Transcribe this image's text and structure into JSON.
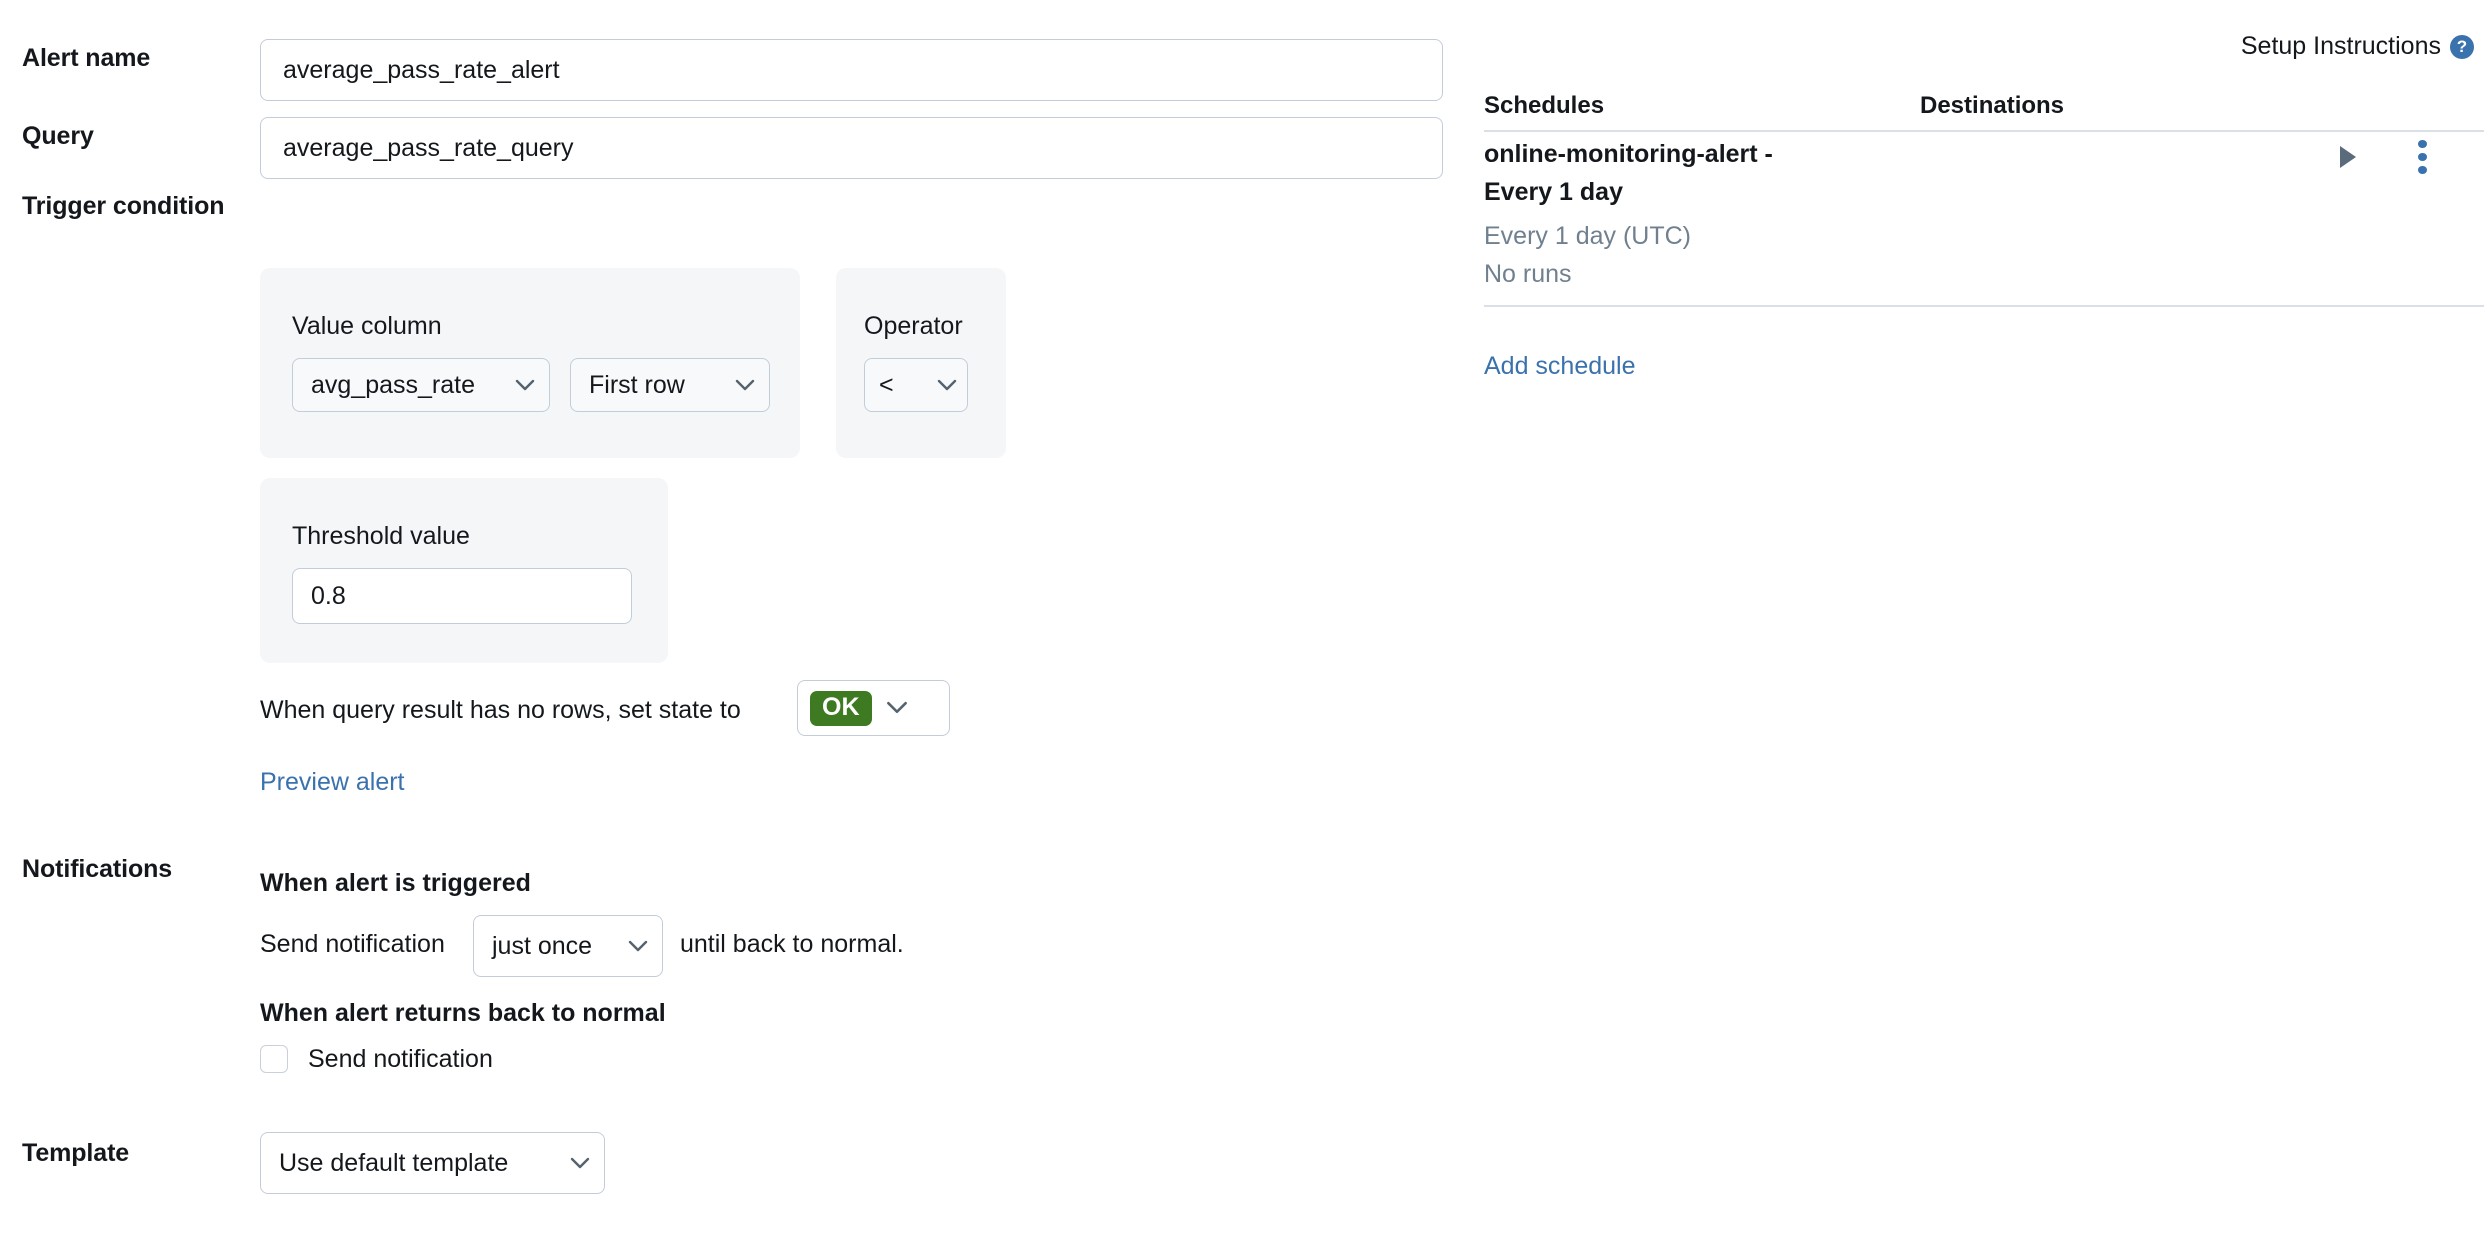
{
  "form": {
    "alert_name": {
      "label": "Alert name",
      "value": "average_pass_rate_alert",
      "placeholder": "Alert name"
    },
    "query": {
      "label": "Query",
      "value": "average_pass_rate_query",
      "placeholder": "Query"
    },
    "trigger_condition": {
      "label": "Trigger condition",
      "value_column": {
        "title": "Value column",
        "column_value": "avg_pass_rate",
        "aggregation_value": "First row"
      },
      "operator": {
        "title": "Operator",
        "value": "<"
      },
      "threshold": {
        "title": "Threshold value",
        "value": "0.8",
        "placeholder": "Threshold value"
      },
      "no_rows": {
        "text": "When query result has no rows, set state to",
        "state": "OK",
        "state_color": "#3d7a22"
      },
      "preview_link": "Preview alert"
    },
    "notifications": {
      "label": "Notifications",
      "when_triggered_heading": "When alert is triggered",
      "send_notification_prefix": "Send notification",
      "frequency_value": "just once",
      "send_notification_suffix": "until back to normal.",
      "when_normal_heading": "When alert returns back to normal",
      "send_notification_checkbox_label": "Send notification",
      "send_notification_checked": false
    },
    "template": {
      "label": "Template",
      "value": "Use default template"
    }
  },
  "side_panel": {
    "setup_instructions": {
      "label": "Setup Instructions",
      "help_icon": "question-mark-circle-icon",
      "help_glyph": "?"
    },
    "columns": {
      "schedules": "Schedules",
      "destinations": "Destinations"
    },
    "schedules": [
      {
        "title": "online-monitoring-alert - Every 1 day",
        "cadence": "Every 1 day (UTC)",
        "runs": "No runs",
        "destinations": "",
        "run_icon": "play-icon",
        "menu_icon": "kebab-menu-icon"
      }
    ],
    "add_schedule_link": "Add schedule"
  },
  "colors": {
    "link": "#3a72ad",
    "panel_bg": "#f4f6f8",
    "border": "#c2cdd9",
    "muted_text": "#70808f",
    "ok_green": "#3d7a22"
  }
}
